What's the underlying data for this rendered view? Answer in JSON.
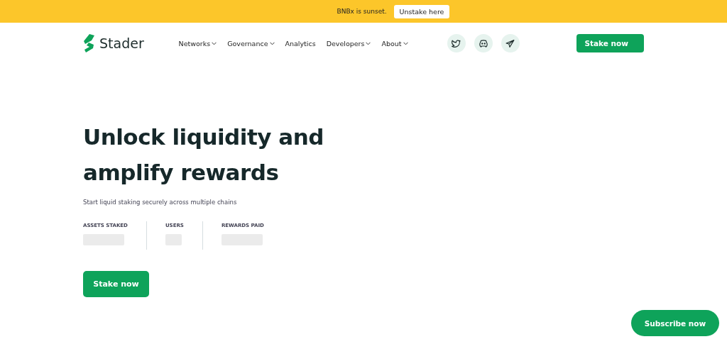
{
  "banner": {
    "text": "BNBx is sunset.",
    "button": "Unstake here"
  },
  "logo": {
    "text": "Stader"
  },
  "nav": [
    {
      "label": "Networks",
      "dropdown": true
    },
    {
      "label": "Governance",
      "dropdown": true
    },
    {
      "label": "Analytics",
      "dropdown": false
    },
    {
      "label": "Developers",
      "dropdown": true
    },
    {
      "label": "About",
      "dropdown": true
    }
  ],
  "socials": [
    {
      "kind": "bird"
    },
    {
      "kind": "discord"
    },
    {
      "kind": "telegram"
    }
  ],
  "header_button": "Stake now",
  "hero": {
    "title_lines": [
      "Unlock liquidity and",
      "amplify rewards"
    ],
    "subtitle": "Start liquid staking securely across multiple chains",
    "stats": [
      {
        "label": "ASSETS STAKED"
      },
      {
        "label": "USERS"
      },
      {
        "label": "REWARDS PAID"
      }
    ],
    "button": "Stake now"
  },
  "subscribe_button": "Subscribe now"
}
